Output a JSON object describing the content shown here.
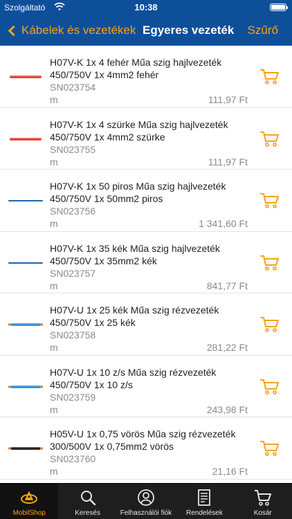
{
  "status": {
    "carrier": "Szolgáltató",
    "time": "10:38"
  },
  "nav": {
    "back_label": "Kábelek és vezetékek",
    "title": "Egyeres vezeték",
    "filter_label": "Szűrő"
  },
  "products": [
    {
      "name": "H07V-K 1x   4  fehér Műa szig hajlvezeték 450/750V 1x  4mm2 fehér",
      "code": "SN023754",
      "unit": "m",
      "price": "111,97 Ft",
      "thumb_color": "#e53935",
      "thumb_type": "sheathed"
    },
    {
      "name": "H07V-K 1x   4  szürke Műa szig hajlvezeték 450/750V 1x  4mm2 szürke",
      "code": "SN023755",
      "unit": "m",
      "price": "111,97 Ft",
      "thumb_color": "#e53935",
      "thumb_type": "sheathed"
    },
    {
      "name": "H07V-K 1x  50  piros Műa szig hajlvezeték 450/750V 1x 50mm2 piros",
      "code": "SN023756",
      "unit": "m",
      "price": "1 341,60 Ft",
      "thumb_color": "#2a6db0",
      "thumb_type": "thin"
    },
    {
      "name": "H07V-K 1x  35  kék Műa szig hajlvezeték 450/750V 1x 35mm2 kék",
      "code": "SN023757",
      "unit": "m",
      "price": "841,77 Ft",
      "thumb_color": "#2a6db0",
      "thumb_type": "thin"
    },
    {
      "name": "H07V-U 1x 25  kék Műa szig rézvezeték 450/750V 1x  25  kék",
      "code": "SN023758",
      "unit": "m",
      "price": "281,22 Ft",
      "thumb_color": "#3a8fd8",
      "thumb_type": "copper"
    },
    {
      "name": "H07V-U 1x 10  z/s Műa szig rézvezeték 450/750V 1x  10  z/s",
      "code": "SN023759",
      "unit": "m",
      "price": "243,98 Ft",
      "thumb_color": "#3a8fd8",
      "thumb_type": "copper"
    },
    {
      "name": "H05V-U 1x   0,75 vörös Műa szig rézvezeték 300/500V 1x   0,75mm2 vörös",
      "code": "SN023760",
      "unit": "m",
      "price": "21,16 Ft",
      "thumb_color": "#222222",
      "thumb_type": "copper"
    }
  ],
  "tabs": [
    {
      "label": "MobilShop",
      "icon": "mobilshop-logo-icon",
      "active": true
    },
    {
      "label": "Keresés",
      "icon": "search-icon",
      "active": false
    },
    {
      "label": "Felhasználói fiók",
      "icon": "user-icon",
      "active": false
    },
    {
      "label": "Rendelések",
      "icon": "orders-document-icon",
      "active": false
    },
    {
      "label": "Kosár",
      "icon": "cart-icon",
      "active": false
    }
  ],
  "colors": {
    "brand_blue": "#0e4f9a",
    "accent_orange": "#f7a21b",
    "tab_bar": "#1e1e1e"
  }
}
